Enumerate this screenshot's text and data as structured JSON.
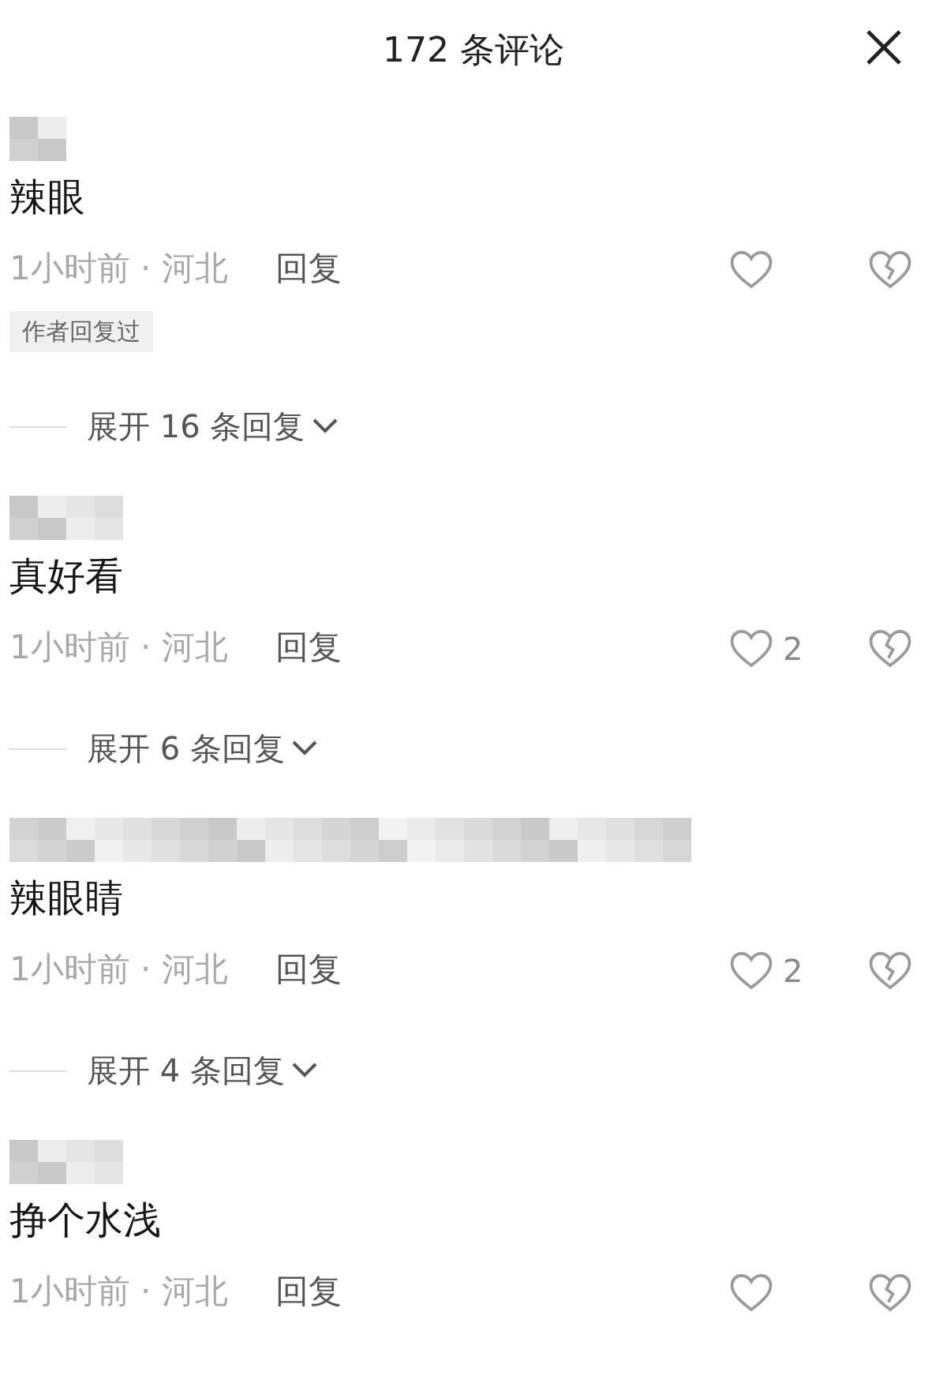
{
  "header": {
    "title": "172 条评论"
  },
  "comments": [
    {
      "text": "辣眼",
      "meta": "1小时前 · 河北",
      "reply": "回复",
      "badge": "作者回复过",
      "expand": "展开 16 条回复"
    },
    {
      "text": "真好看",
      "meta": "1小时前 · 河北",
      "reply": "回复",
      "likes": "2",
      "expand": "展开 6 条回复"
    },
    {
      "text": "辣眼睛",
      "meta": "1小时前 · 河北",
      "reply": "回复",
      "likes": "2",
      "expand": "展开 4 条回复"
    },
    {
      "text": "挣个水浅",
      "meta": "1小时前 · 河北",
      "reply": "回复"
    }
  ]
}
